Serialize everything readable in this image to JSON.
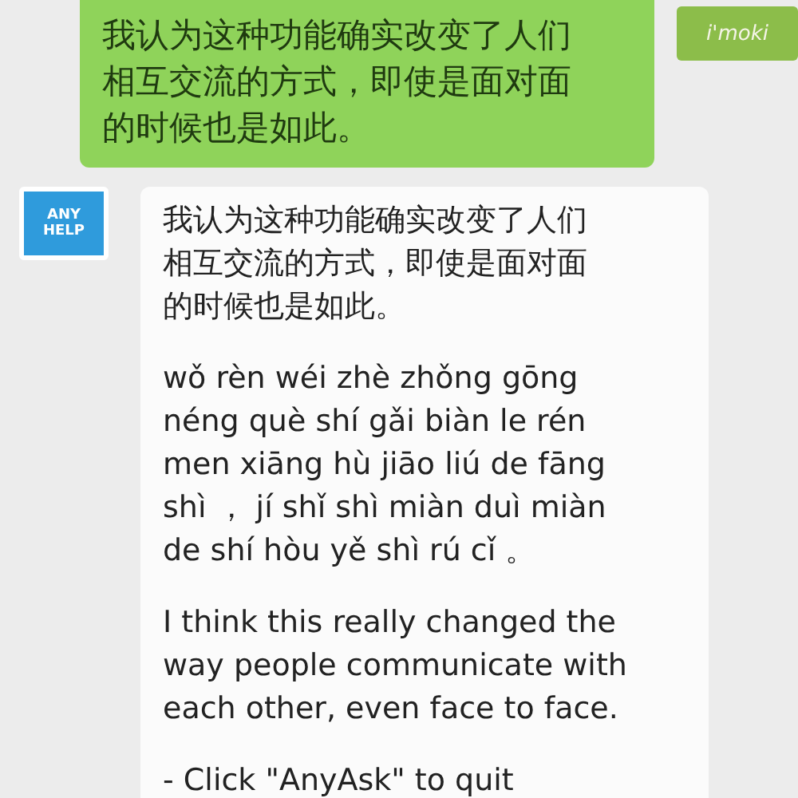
{
  "messages": [
    {
      "kind": "sent",
      "avatar": {
        "label": "i'moki"
      },
      "paragraphs": [
        [
          "我认为这种功能确实改变了人们",
          "相互交流的方式，即使是面对面",
          "的时候也是如此。"
        ]
      ]
    },
    {
      "kind": "received",
      "avatar": {
        "label": "ANY HELP"
      },
      "paragraphs": [
        [
          "我认为这种功能确实改变了人们",
          "相互交流的方式，即使是面对面",
          "的时候也是如此。"
        ],
        [
          "wǒ rèn wéi zhè zhǒng gōng",
          "néng què shí gǎi biàn le rén",
          "men xiāng hù jiāo liú de fāng",
          "shì ， jí shǐ shì miàn duì miàn",
          "de shí hòu yě shì rú cǐ 。"
        ],
        [
          "I think this really changed the",
          "way people communicate with",
          "each other, even face to face."
        ],
        [
          "- Click \"AnyAsk\" to quit"
        ]
      ]
    }
  ]
}
